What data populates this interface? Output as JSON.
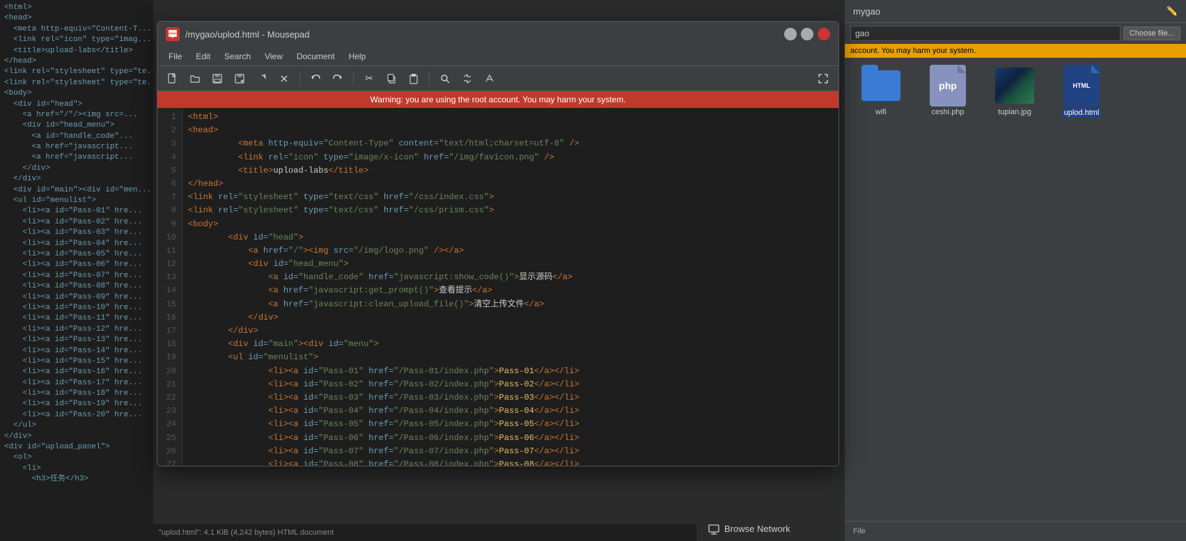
{
  "window": {
    "title": "/mygao/uplod.html - Mousepad",
    "app_icon_label": "M",
    "warning_text": "Warning: you are using the root account. You may harm your system."
  },
  "menu": {
    "items": [
      "File",
      "Edit",
      "Search",
      "View",
      "Document",
      "Help"
    ]
  },
  "toolbar": {
    "buttons": [
      {
        "name": "new",
        "icon": "📄"
      },
      {
        "name": "open",
        "icon": "📂"
      },
      {
        "name": "save",
        "icon": "💾"
      },
      {
        "name": "save-as",
        "icon": "📥"
      },
      {
        "name": "reload",
        "icon": "🔄"
      },
      {
        "name": "close",
        "icon": "✕"
      },
      {
        "name": "undo",
        "icon": "↩"
      },
      {
        "name": "redo",
        "icon": "↪"
      },
      {
        "name": "cut",
        "icon": "✂"
      },
      {
        "name": "copy",
        "icon": "📋"
      },
      {
        "name": "paste",
        "icon": "📌"
      },
      {
        "name": "find",
        "icon": "🔍"
      },
      {
        "name": "replace",
        "icon": "🔁"
      },
      {
        "name": "spell",
        "icon": "🔄"
      }
    ]
  },
  "code": {
    "lines": [
      {
        "num": 1,
        "content": "<html>"
      },
      {
        "num": 2,
        "content": "<head>"
      },
      {
        "num": 3,
        "content": "    <meta http-equiv=\"Content-Type\" content=\"text/html;charset=utf-8\" />"
      },
      {
        "num": 4,
        "content": "    <link rel=\"icon\" type=\"image/x-icon\" href=\"/img/favicon.png\" />"
      },
      {
        "num": 5,
        "content": "    <title>upload-labs</title>"
      },
      {
        "num": 6,
        "content": "</head>"
      },
      {
        "num": 7,
        "content": "<link rel=\"stylesheet\" type=\"text/css\" href=\"/css/index.css\">"
      },
      {
        "num": 8,
        "content": "<link rel=\"stylesheet\" type=\"text/css\" href=\"/css/prism.css\">"
      },
      {
        "num": 9,
        "content": "<body>"
      },
      {
        "num": 10,
        "content": "    <div id=\"head\">"
      },
      {
        "num": 11,
        "content": "        <a href=\"/\"><img src=\"/img/logo.png\" /></a>"
      },
      {
        "num": 12,
        "content": "        <div id=\"head_menu\">"
      },
      {
        "num": 13,
        "content": "            <a id=\"handle_code\" href=\"javascript:show_code()\">显示源码</a>"
      },
      {
        "num": 14,
        "content": "            <a href=\"javascript:get_prompt()\">查看提示</a>"
      },
      {
        "num": 15,
        "content": "            <a href=\"javascript:clean_upload_file()\">清空上传文件</a>"
      },
      {
        "num": 16,
        "content": "        </div>"
      },
      {
        "num": 17,
        "content": "    </div>"
      },
      {
        "num": 18,
        "content": "    <div id=\"main\"><div id=\"menu\">"
      },
      {
        "num": 19,
        "content": "    <ul id=\"menulist\">"
      },
      {
        "num": 20,
        "content": "            <li><a id=\"Pass-01\" href=\"/Pass-01/index.php\">Pass-01</a></li>"
      },
      {
        "num": 21,
        "content": "            <li><a id=\"Pass-02\" href=\"/Pass-02/index.php\">Pass-02</a></li>"
      },
      {
        "num": 22,
        "content": "            <li><a id=\"Pass-03\" href=\"/Pass-03/index.php\">Pass-03</a></li>"
      },
      {
        "num": 23,
        "content": "            <li><a id=\"Pass-04\" href=\"/Pass-04/index.php\">Pass-04</a></li>"
      },
      {
        "num": 24,
        "content": "            <li><a id=\"Pass-05\" href=\"/Pass-05/index.php\">Pass-05</a></li>"
      },
      {
        "num": 25,
        "content": "            <li><a id=\"Pass-06\" href=\"/Pass-06/index.php\">Pass-06</a></li>"
      },
      {
        "num": 26,
        "content": "            <li><a id=\"Pass-07\" href=\"/Pass-07/index.php\">Pass-07</a></li>"
      },
      {
        "num": 27,
        "content": "            <li><a id=\"Pass-08\" href=\"/Pass-08/index.php\">Pass-08</a></li>"
      }
    ]
  },
  "status_bar": {
    "text": "\"uplod.html\": 4.1 KiB (4,242 bytes) HTML document"
  },
  "right_panel": {
    "title": "mygao",
    "address": "gao",
    "warning": "account. You may harm your system.",
    "choose_file_label": "Choose file...",
    "files": [
      {
        "name": "wifi",
        "type": "folder"
      },
      {
        "name": "ceshi.php",
        "type": "php"
      },
      {
        "name": "tupian.jpg",
        "type": "image"
      },
      {
        "name": "uplod.html",
        "type": "html",
        "selected": true
      }
    ],
    "bottom_label": "File"
  },
  "bottom": {
    "browse_network": "Browse Network"
  }
}
